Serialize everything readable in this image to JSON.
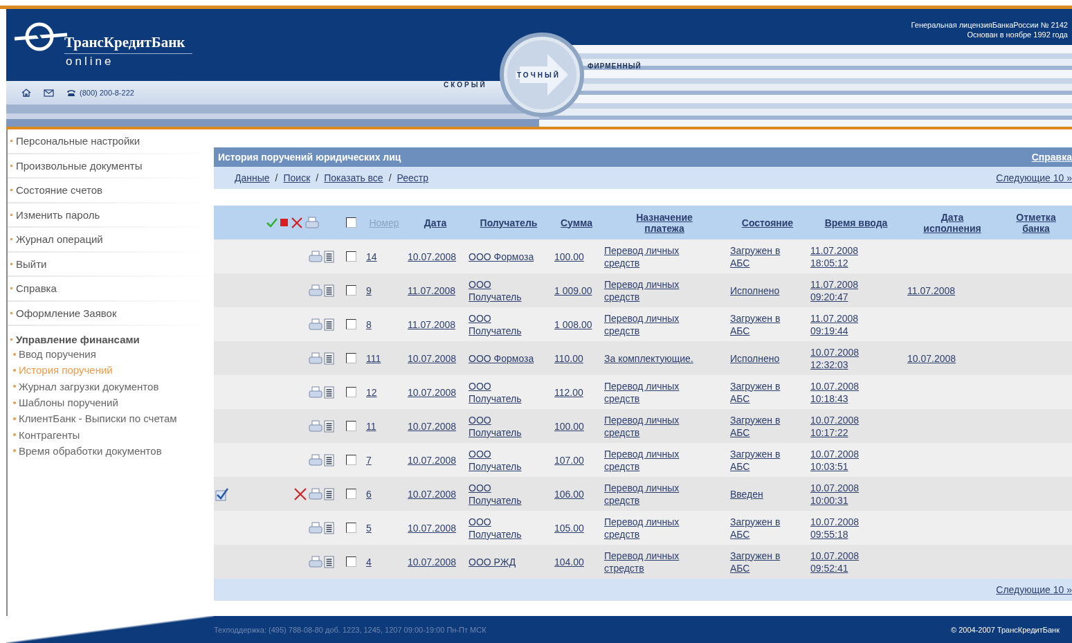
{
  "header": {
    "bank_name": "ТрансКредитБанк",
    "subtitle": "online",
    "phone": "(800) 200-8-222",
    "license": "Генеральная лицензияБанкаРоссии № 2142",
    "founded": "Основан в ноябре 1992 года",
    "slogans": [
      "СКОРЫЙ",
      "ТОЧНЫЙ",
      "ФИРМЕННЫЙ"
    ]
  },
  "sidebar": {
    "items": [
      {
        "label": "Персональные настройки"
      },
      {
        "label": "Произвольные документы"
      },
      {
        "label": "Состояние счетов"
      },
      {
        "label": "Изменить пароль"
      },
      {
        "label": "Журнал операций"
      },
      {
        "label": "Выйти"
      },
      {
        "label": "Справка"
      },
      {
        "label": "Оформление Заявок"
      },
      {
        "label": "Управление финансами",
        "children": [
          {
            "label": "Ввод поручения",
            "selected": false
          },
          {
            "label": "История поручений",
            "selected": true
          },
          {
            "label": "Журнал загрузки документов",
            "selected": false
          },
          {
            "label": "Шаблоны поручений",
            "selected": false
          },
          {
            "label": "КлиентБанк - Выписки по счетам",
            "selected": false
          },
          {
            "label": "Контрагенты",
            "selected": false
          },
          {
            "label": "Время обработки документов",
            "selected": false
          }
        ]
      }
    ]
  },
  "panel": {
    "title": "История поручений юридических лиц",
    "help_link": "Справка",
    "links": [
      "Данные",
      "Поиск",
      "Показать все",
      "Реестр"
    ],
    "separator": "/",
    "next_top": "Следующие 10 »",
    "next_bottom": "Следующие 10 »"
  },
  "table": {
    "select_all_checked": false,
    "columns": [
      {
        "label": "Номер",
        "sorted": true
      },
      {
        "label": "Дата",
        "sorted": false
      },
      {
        "label": "Получатель",
        "sorted": false
      },
      {
        "label": "Сумма",
        "sorted": false
      },
      {
        "label": "Назначение платежа",
        "sorted": false
      },
      {
        "label": "Состояние",
        "sorted": false
      },
      {
        "label": "Время ввода",
        "sorted": false
      },
      {
        "label": "Дата исполнения",
        "sorted": false
      },
      {
        "label": "Отметка банка",
        "sorted": false
      }
    ],
    "rows": [
      {
        "marked": false,
        "deletable": false,
        "checked": false,
        "number": "14",
        "date": "10.07.2008",
        "recipient": "ООО Формоза",
        "amount": "100.00",
        "purpose": "Перевод личных средств",
        "status": "Загружен в АБС",
        "entered": "11.07.2008 18:05:12",
        "executed": ""
      },
      {
        "marked": false,
        "deletable": false,
        "checked": false,
        "number": "9",
        "date": "11.07.2008",
        "recipient": "ООО Получатель",
        "amount": "1 009.00",
        "purpose": "Перевод личных средств",
        "status": "Исполнено",
        "entered": "11.07.2008 09:20:47",
        "executed": "11.07.2008"
      },
      {
        "marked": false,
        "deletable": false,
        "checked": false,
        "number": "8",
        "date": "11.07.2008",
        "recipient": "ООО Получатель",
        "amount": "1 008.00",
        "purpose": "Перевод личных средств",
        "status": "Загружен в АБС",
        "entered": "11.07.2008 09:19:44",
        "executed": ""
      },
      {
        "marked": false,
        "deletable": false,
        "checked": false,
        "number": "111",
        "date": "10.07.2008",
        "recipient": "ООО Формоза",
        "amount": "110.00",
        "purpose": "За комплектующие.",
        "status": "Исполнено",
        "entered": "10.07.2008 12:32:03",
        "executed": "10.07.2008"
      },
      {
        "marked": false,
        "deletable": false,
        "checked": false,
        "number": "12",
        "date": "10.07.2008",
        "recipient": "ООО Получатель",
        "amount": "112.00",
        "purpose": "Перевод личных средств",
        "status": "Загружен в АБС",
        "entered": "10.07.2008 10:18:43",
        "executed": ""
      },
      {
        "marked": false,
        "deletable": false,
        "checked": false,
        "number": "11",
        "date": "10.07.2008",
        "recipient": "ООО Получатель",
        "amount": "100.00",
        "purpose": "Перевод личных средств",
        "status": "Загружен в АБС",
        "entered": "10.07.2008 10:17:22",
        "executed": ""
      },
      {
        "marked": false,
        "deletable": false,
        "checked": false,
        "number": "7",
        "date": "10.07.2008",
        "recipient": "ООО Получатель",
        "amount": "107.00",
        "purpose": "Перевод личных средств",
        "status": "Загружен в АБС",
        "entered": "10.07.2008 10:03:51",
        "executed": ""
      },
      {
        "marked": true,
        "deletable": true,
        "checked": false,
        "number": "6",
        "date": "10.07.2008",
        "recipient": "ООО Получатель",
        "amount": "106.00",
        "purpose": "Перевод личных средств",
        "status": "Введен",
        "entered": "10.07.2008 10:00:31",
        "executed": ""
      },
      {
        "marked": false,
        "deletable": false,
        "checked": false,
        "number": "5",
        "date": "10.07.2008",
        "recipient": "ООО Получатель",
        "amount": "105.00",
        "purpose": "Перевод личных средств",
        "status": "Загружен в АБС",
        "entered": "10.07.2008 09:55:18",
        "executed": ""
      },
      {
        "marked": false,
        "deletable": false,
        "checked": false,
        "number": "4",
        "date": "10.07.2008",
        "recipient": "ООО РЖД",
        "amount": "104.00",
        "purpose": "Перевод личных стредств",
        "status": "Загружен в АБС",
        "entered": "10.07.2008 09:52:41",
        "executed": ""
      }
    ]
  },
  "footer": {
    "support": "Техподдержка: (495) 788-08-80 доб. 1223, 1245, 1207 09:00-19:00 Пн-Пт МСК",
    "copyright": "© 2004-2007 ТрансКредитБанк"
  }
}
